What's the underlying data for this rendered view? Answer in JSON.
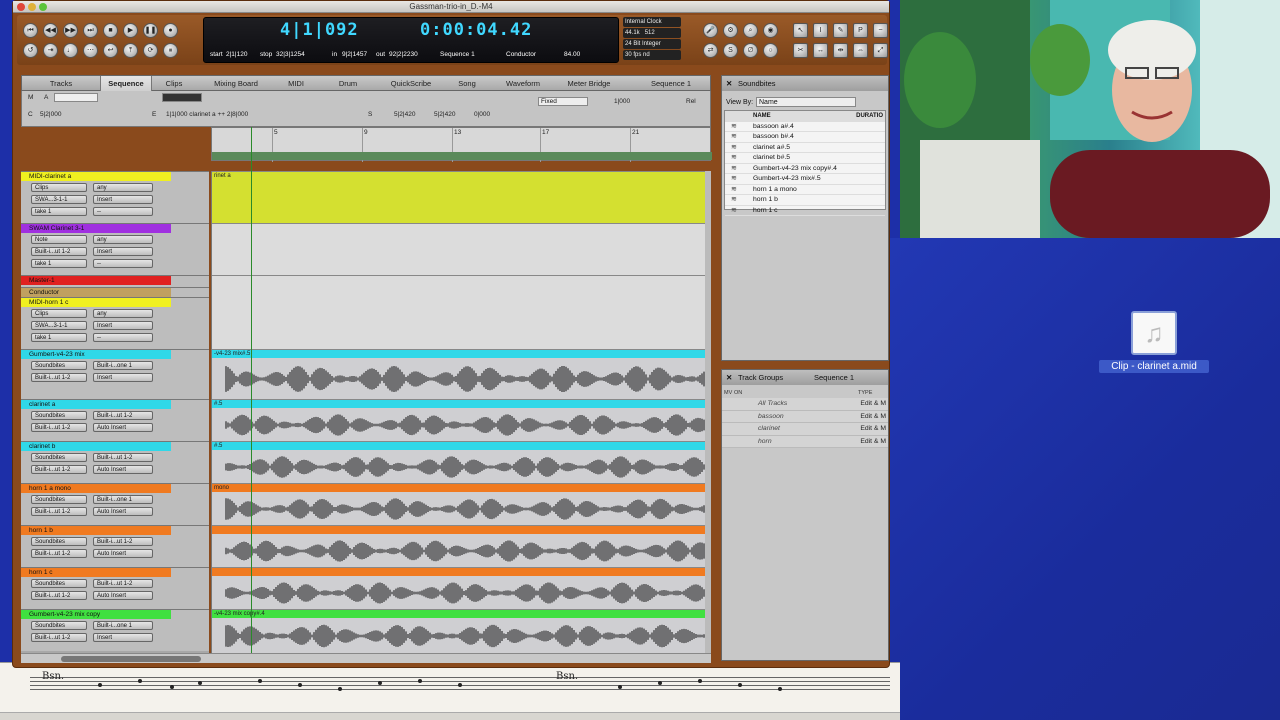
{
  "app": {
    "window_title": "Gassman-trio-in_D.-M4"
  },
  "transport": {
    "counter_measure": "4|1|092",
    "counter_time": "0:00:04.42",
    "start_label": "start",
    "start_value": "2|1|120",
    "stop_label": "stop",
    "stop_value": "32|3|1254",
    "in_label": "in",
    "in_value": "9|2|1457",
    "out_label": "out",
    "out_value": "92|2|2230",
    "sequence_value": "Sequence 1",
    "conductor_label": "Conductor",
    "tempo_value": "84.00",
    "clock_source": "Internal Clock",
    "sample_rate": "44.1k",
    "buffer": "512",
    "bit_depth": "24 Bit Integer",
    "frame_rate": "30 fps nd"
  },
  "tabs": [
    {
      "label": "Tracks"
    },
    {
      "label": "Sequence"
    },
    {
      "label": "Clips"
    },
    {
      "label": "Mixing Board"
    },
    {
      "label": "MIDI"
    },
    {
      "label": "Drum"
    },
    {
      "label": "QuickScribe"
    },
    {
      "label": "Song"
    },
    {
      "label": "Waveform"
    },
    {
      "label": "Meter Bridge"
    },
    {
      "label": "Sequence 1"
    }
  ],
  "seq_toolbar": {
    "m": "M",
    "a": "A",
    "c": "C",
    "c_value": "5|2|000",
    "e": "E",
    "e_value": "1|1|000  clarinet a ++  2|8|000",
    "fixed": "Fixed",
    "grid": "1|000",
    "rel": "Rel",
    "s": "S",
    "s_value": "5|2|420",
    "s_value2": "5|2|420",
    "s_value3": "0|000"
  },
  "ruler": {
    "marks": [
      {
        "label": "5"
      },
      {
        "label": "9"
      },
      {
        "label": "13"
      },
      {
        "label": "17"
      },
      {
        "label": "21"
      }
    ]
  },
  "track_list": [
    {
      "name": "MIDI-clarinet a",
      "color": "#f0f020",
      "rows": [
        "Clips",
        "SWA...3-1-1",
        "take 1"
      ],
      "right": [
        "any",
        "Insert",
        "--"
      ]
    },
    {
      "name": "SWAM Clarinet 3-1",
      "color": "#a030e0",
      "rows": [
        "Note",
        "Built-i...ut 1-2",
        "take 1"
      ],
      "right": [
        "any",
        "Insert",
        "--"
      ]
    },
    {
      "name": "Master-1",
      "color": "#e02020",
      "rows": [
        "Built-i...ut 1-2"
      ],
      "right": []
    },
    {
      "name": "Conductor",
      "color": "#c0a060",
      "rows": [],
      "right": []
    },
    {
      "name": "MIDI-horn 1 c",
      "color": "#f0f020",
      "rows": [
        "Clips",
        "SWA...3-1-1",
        "take 1"
      ],
      "right": [
        "any",
        "Insert",
        "--"
      ]
    },
    {
      "name": "Gumbert-v4-23 mix",
      "color": "#30d8e8",
      "rows": [
        "Soundbites",
        "Built-i...ut 1-2"
      ],
      "right": [
        "Built-i...one 1",
        "Insert"
      ]
    },
    {
      "name": "clarinet a",
      "color": "#30d8e8",
      "rows": [
        "Soundbites",
        "Built-i...ut 1-2"
      ],
      "right": [
        "Built-i...ut 1-2",
        "Auto Insert"
      ]
    },
    {
      "name": "clarinet b",
      "color": "#30d8e8",
      "rows": [
        "Soundbites",
        "Built-i...ut 1-2"
      ],
      "right": [
        "Built-i...ut 1-2",
        "Auto Insert"
      ]
    },
    {
      "name": "horn 1 a mono",
      "color": "#f07a20",
      "rows": [
        "Soundbites",
        "Built-i...ut 1-2"
      ],
      "right": [
        "Built-i...one 1",
        "Auto Insert"
      ]
    },
    {
      "name": "horn 1 b",
      "color": "#f07a20",
      "rows": [
        "Soundbites",
        "Built-i...ut 1-2"
      ],
      "right": [
        "Built-i...ut 1-2",
        "Auto Insert"
      ]
    },
    {
      "name": "horn 1 c",
      "color": "#f07a20",
      "rows": [
        "Soundbites",
        "Built-i...ut 1-2"
      ],
      "right": [
        "Built-i...ut 1-2",
        "Auto Insert"
      ]
    },
    {
      "name": "Gumbert-v4-23 mix copy",
      "color": "#40e040",
      "rows": [
        "Soundbites",
        "Built-i...ut 1-2"
      ],
      "right": [
        "Built-i...one 1",
        "Insert"
      ]
    }
  ],
  "lanes": [
    {
      "label": "rinet a",
      "color": "#d4e030"
    },
    {
      "label": "",
      "color": "#dcdcdc"
    },
    {
      "label": "",
      "color": "#dcdcdc"
    },
    {
      "label": "-v4-23 mix#.5",
      "color": "#30d8e8"
    },
    {
      "label": "#.5",
      "color": "#30d8e8"
    },
    {
      "label": "#.5",
      "color": "#30d8e8"
    },
    {
      "label": "mono",
      "color": "#f07a20"
    },
    {
      "label": "",
      "color": "#f07a20"
    },
    {
      "label": "",
      "color": "#f07a20"
    },
    {
      "label": "-v4-23 mix copy#.4",
      "color": "#40e040"
    }
  ],
  "soundbites": {
    "tab_label": "Soundbites",
    "view_by_label": "View By:",
    "view_by_value": "Name",
    "col_name": "NAME",
    "col_duration": "DURATIO",
    "items": [
      {
        "name": "bassoon a#.4"
      },
      {
        "name": "bassoon b#.4"
      },
      {
        "name": "clarinet a#.5"
      },
      {
        "name": "clarinet b#.5"
      },
      {
        "name": "Gumbert-v4-23 mix copy#.4"
      },
      {
        "name": "Gumbert-v4-23 mix#.5"
      },
      {
        "name": "horn 1 a mono"
      },
      {
        "name": "horn 1 b"
      },
      {
        "name": "horn 1 c"
      }
    ]
  },
  "track_groups": {
    "tab_label": "Track Groups",
    "tab2_label": "Sequence 1",
    "col_mv": "MV",
    "col_on": "ON",
    "col_type": "TYPE",
    "items": [
      {
        "name": "All Tracks",
        "type": "Edit & M"
      },
      {
        "name": "bassoon",
        "type": "Edit & M"
      },
      {
        "name": "clarinet",
        "type": "Edit & M"
      },
      {
        "name": "horn",
        "type": "Edit & M"
      }
    ]
  },
  "score": {
    "staff1_label": "Bsn.",
    "staff2_label": "Bsn."
  },
  "desktop": {
    "file_label": "Clip - clarinet a.mid",
    "file_icon": "music-note-icon"
  }
}
